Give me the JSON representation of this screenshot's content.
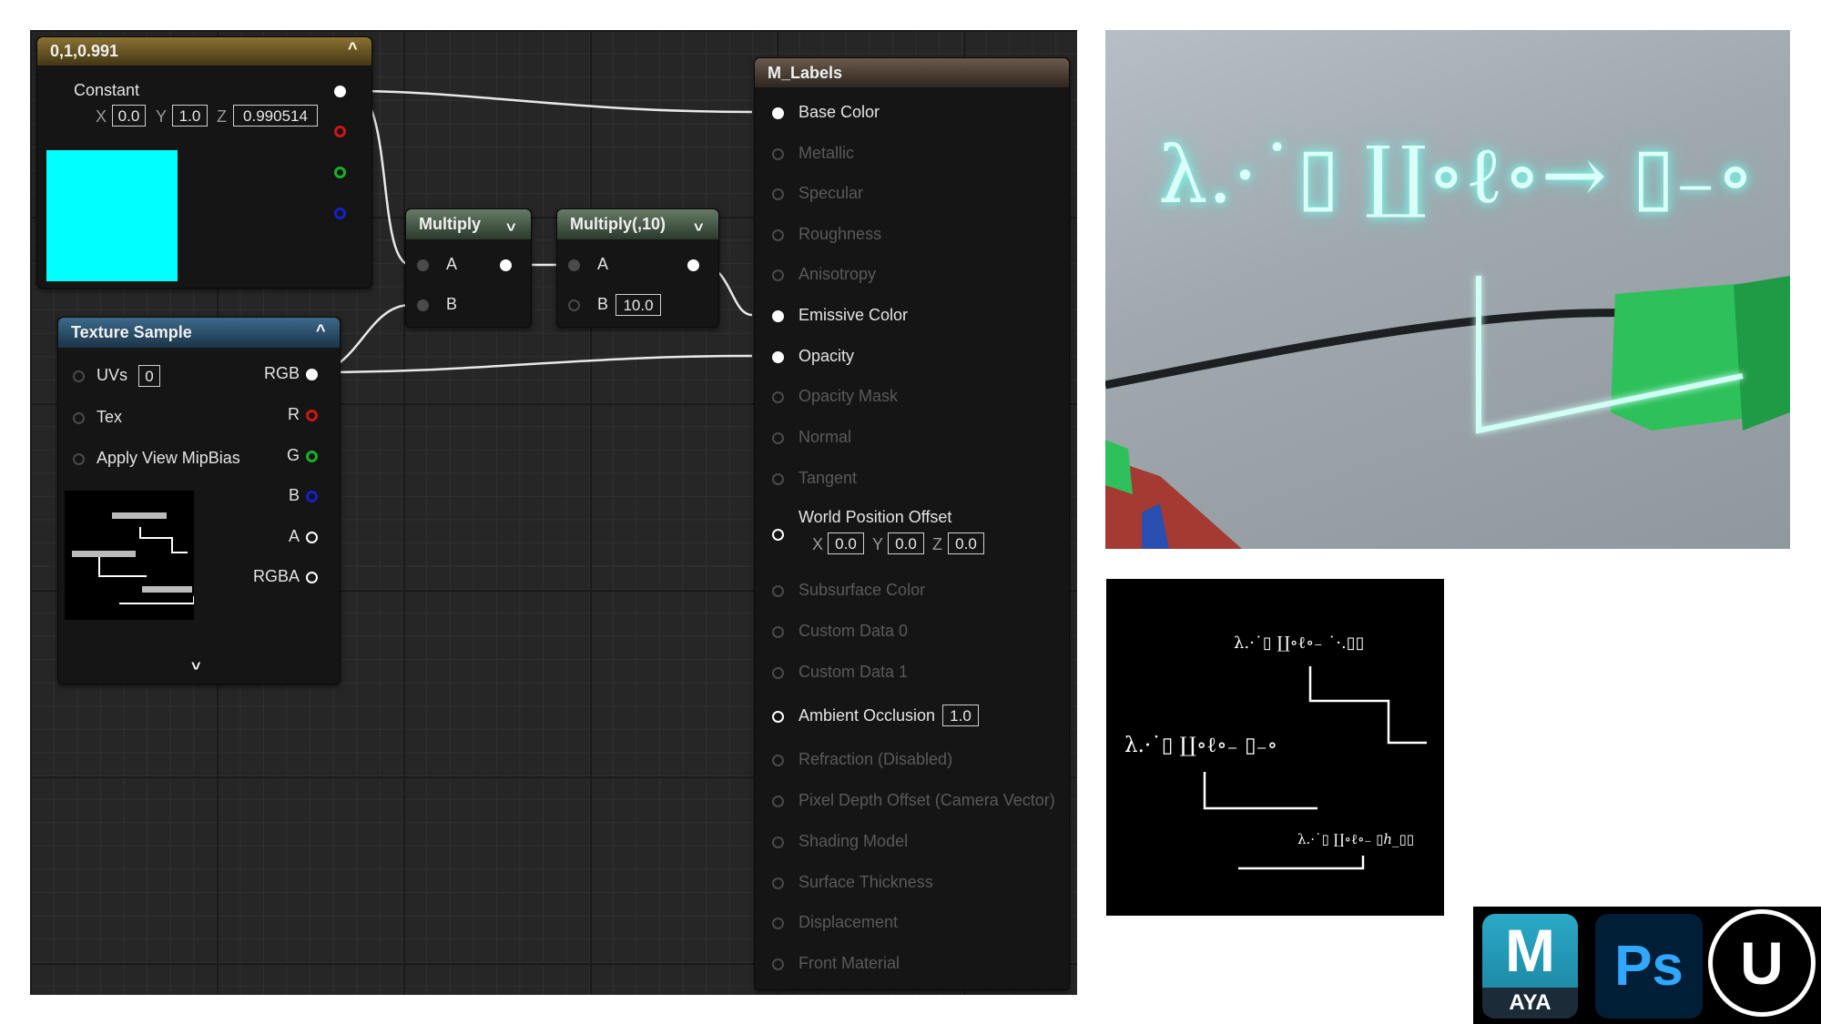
{
  "constant_node": {
    "title": "0,1,0.991",
    "pin_label": "Constant",
    "x_label": "X",
    "x_value": "0.0",
    "y_label": "Y",
    "y_value": "1.0",
    "z_label": "Z",
    "z_value": "0.990514",
    "swatch_color": "#00ffff"
  },
  "texture_node": {
    "title": "Texture Sample",
    "uvs_label": "UVs",
    "uvs_value": "0",
    "tex_label": "Tex",
    "mip_label": "Apply View MipBias",
    "outputs": [
      "RGB",
      "R",
      "G",
      "B",
      "A",
      "RGBA"
    ]
  },
  "multiply_node": {
    "title": "Multiply",
    "pin_a": "A",
    "pin_b": "B"
  },
  "multiply10_node": {
    "title": "Multiply(,10)",
    "pin_a": "A",
    "pin_b": "B",
    "b_value": "10.0"
  },
  "material_node": {
    "title": "M_Labels",
    "pins": {
      "base_color": "Base Color",
      "metallic": "Metallic",
      "specular": "Specular",
      "roughness": "Roughness",
      "anisotropy": "Anisotropy",
      "emissive": "Emissive Color",
      "opacity": "Opacity",
      "opacity_mask": "Opacity Mask",
      "normal": "Normal",
      "tangent": "Tangent",
      "wpo": "World Position Offset",
      "subsurface": "Subsurface Color",
      "custom0": "Custom Data 0",
      "custom1": "Custom Data 1",
      "ao": "Ambient Occlusion",
      "refraction": "Refraction (Disabled)",
      "pdo": "Pixel Depth Offset (Camera Vector)",
      "shading": "Shading Model",
      "thickness": "Surface Thickness",
      "displacement": "Displacement",
      "front": "Front Material"
    },
    "wpo_x": "0.0",
    "wpo_y": "0.0",
    "wpo_z": "0.0",
    "ao_value": "1.0",
    "x_label": "X",
    "y_label": "Y",
    "z_label": "Z"
  },
  "viewport_text": "λ.·˙▯ ∐∘ℓ∘→ ▯₋∘",
  "texture_preview": {
    "line1": "λ.·˙▯ ∐∘ℓ∘₋ ˙·.▯▯",
    "line2": "λ.·˙▯ ∐∘ℓ∘₋ ▯₋∘",
    "line3": "λ.·˙▯ ∐∘ℓ∘₋ ▯ℎ_▯▯"
  },
  "logos": {
    "maya_letter": "M",
    "maya_text": "AYA",
    "ps_text": "Ps",
    "unreal_letter": "U"
  },
  "colors": {
    "maya": "#2aa9c8",
    "photoshop_bg": "#001e36",
    "photoshop_text": "#31a8ff",
    "glow": "#b8fff4"
  }
}
